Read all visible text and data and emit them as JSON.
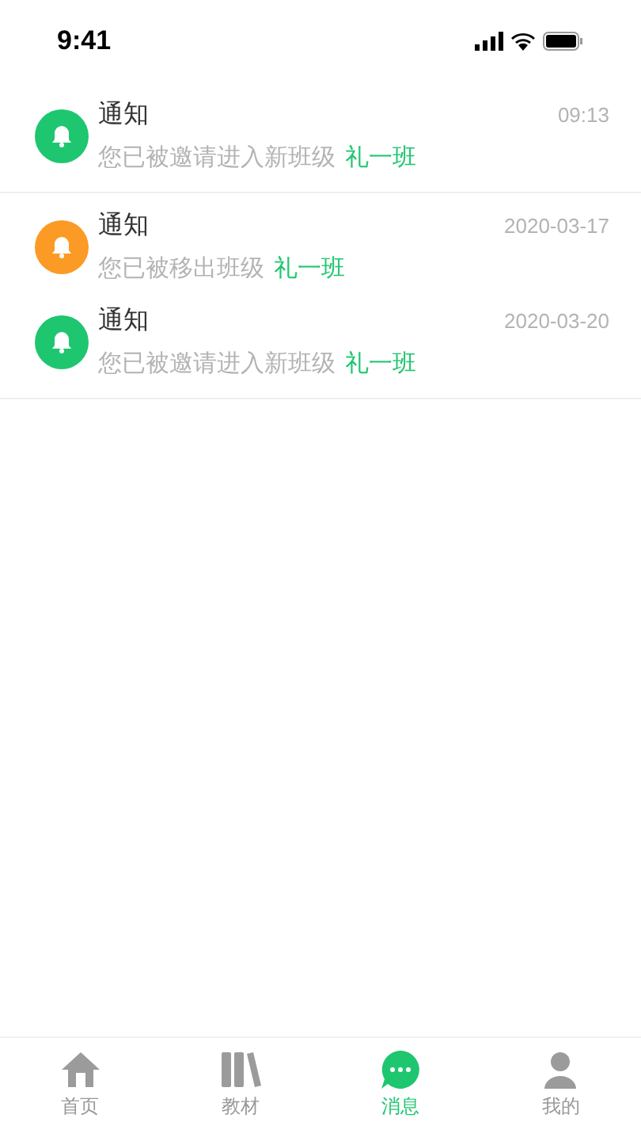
{
  "status_bar": {
    "time": "9:41"
  },
  "message_groups": [
    {
      "messages": [
        {
          "title": "通知",
          "time": "09:13",
          "text": "您已被邀请进入新班级",
          "class_name": "礼一班",
          "color": "#1ec66f"
        }
      ]
    },
    {
      "messages": [
        {
          "title": "通知",
          "time": "2020-03-17",
          "text": "您已被移出班级",
          "class_name": "礼一班",
          "color": "#fb9a24"
        },
        {
          "title": "通知",
          "time": "2020-03-20",
          "text": "您已被邀请进入新班级",
          "class_name": "礼一班",
          "color": "#1ec66f"
        }
      ]
    }
  ],
  "tab_bar": [
    {
      "kind": "home",
      "label": "首页",
      "selected": false
    },
    {
      "kind": "books",
      "label": "教材",
      "selected": false
    },
    {
      "kind": "chat",
      "label": "消息",
      "selected": true
    },
    {
      "kind": "user",
      "label": "我的",
      "selected": false
    }
  ]
}
